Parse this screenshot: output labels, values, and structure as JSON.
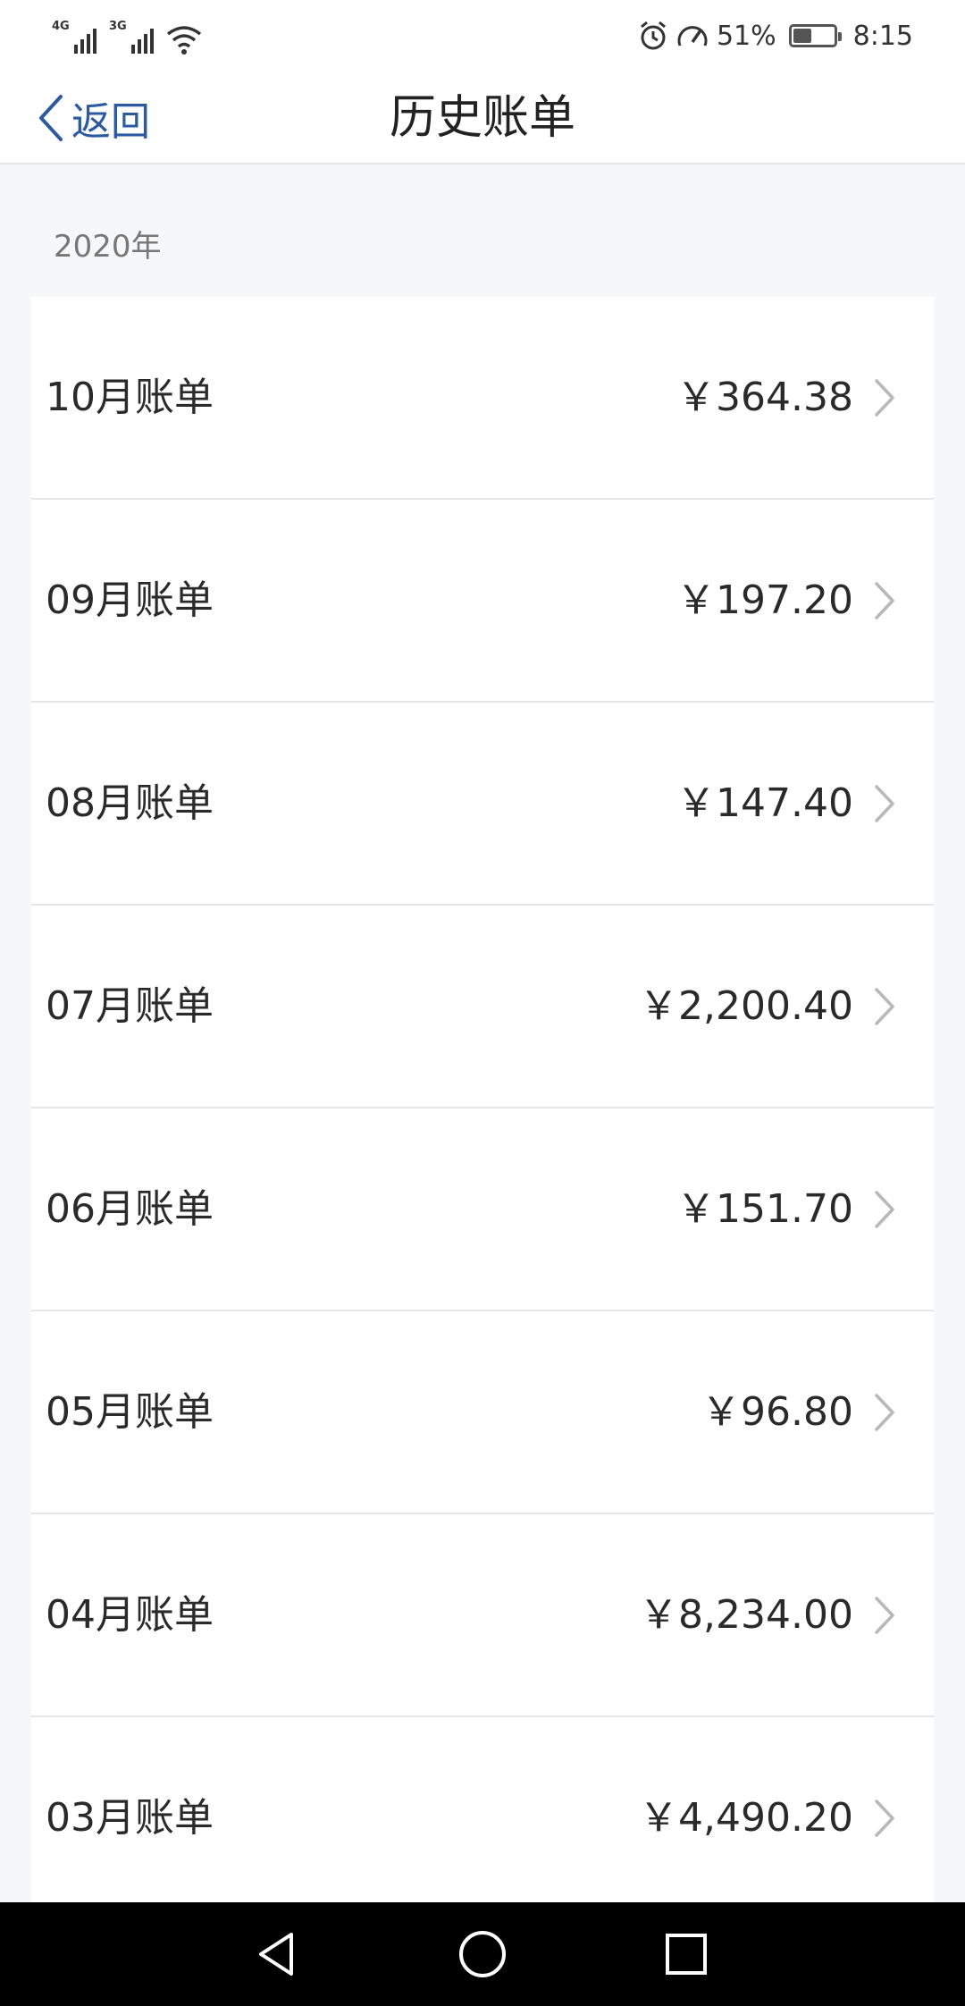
{
  "status_bar": {
    "network_1": "4G",
    "network_2": "3G",
    "battery_percent": "51%",
    "battery_level": 0.51,
    "time": "8:15",
    "icons": [
      "signal-icon",
      "signal-icon",
      "wifi-icon",
      "alarm-icon",
      "speed-icon",
      "battery-icon"
    ]
  },
  "navbar": {
    "back_label": "返回",
    "title": "历史账单"
  },
  "section": {
    "year": "2020年"
  },
  "bills": [
    {
      "label": "10月账单",
      "amount": "￥364.38"
    },
    {
      "label": "09月账单",
      "amount": "￥197.20"
    },
    {
      "label": "08月账单",
      "amount": "￥147.40"
    },
    {
      "label": "07月账单",
      "amount": "￥2,200.40"
    },
    {
      "label": "06月账单",
      "amount": "￥151.70"
    },
    {
      "label": "05月账单",
      "amount": "￥96.80"
    },
    {
      "label": "04月账单",
      "amount": "￥8,234.00"
    },
    {
      "label": "03月账单",
      "amount": "￥4,490.20"
    }
  ],
  "colors": {
    "accent": "#2c5aa0",
    "background": "#f6f7f8",
    "card": "#ffffff",
    "text": "#2a2a2a",
    "muted": "#777777",
    "chevron": "#b8b8b8"
  },
  "system_nav": {
    "icons": [
      "back-triangle-icon",
      "home-circle-icon",
      "recents-square-icon"
    ]
  }
}
